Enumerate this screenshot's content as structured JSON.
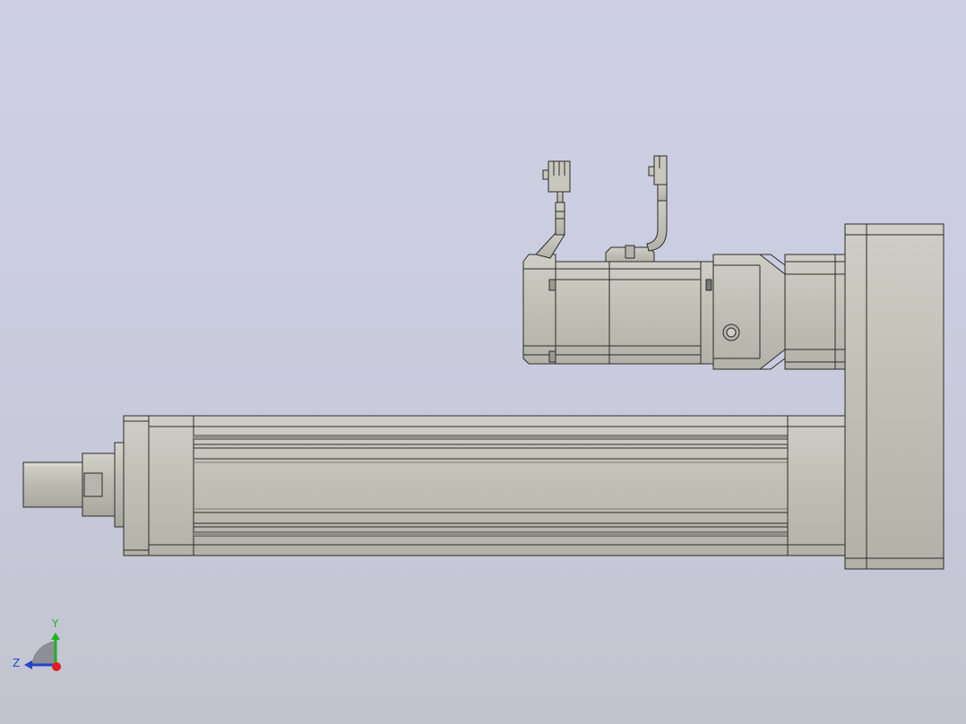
{
  "viewport": {
    "background_top": "#cfd0e6",
    "background_bottom": "#c2c4cf"
  },
  "model": {
    "body_color": "#c0bfb5",
    "edge_color": "#2b2b2b",
    "shadow_color": "#8f8e86",
    "highlight_color": "#d8d7cf",
    "parts": [
      "actuator-tube",
      "actuator-end-cap",
      "rod-end",
      "motor-adapter-housing",
      "gearbox",
      "servo-motor",
      "motor-cable-1",
      "motor-cable-2",
      "connector-1",
      "connector-2"
    ]
  },
  "triad": {
    "labels": {
      "y": "Y",
      "z": "Z"
    },
    "colors": {
      "y": "#22b022",
      "z": "#2244cc",
      "x": "#e02020"
    },
    "icon": "view-orientation-triad-icon"
  }
}
